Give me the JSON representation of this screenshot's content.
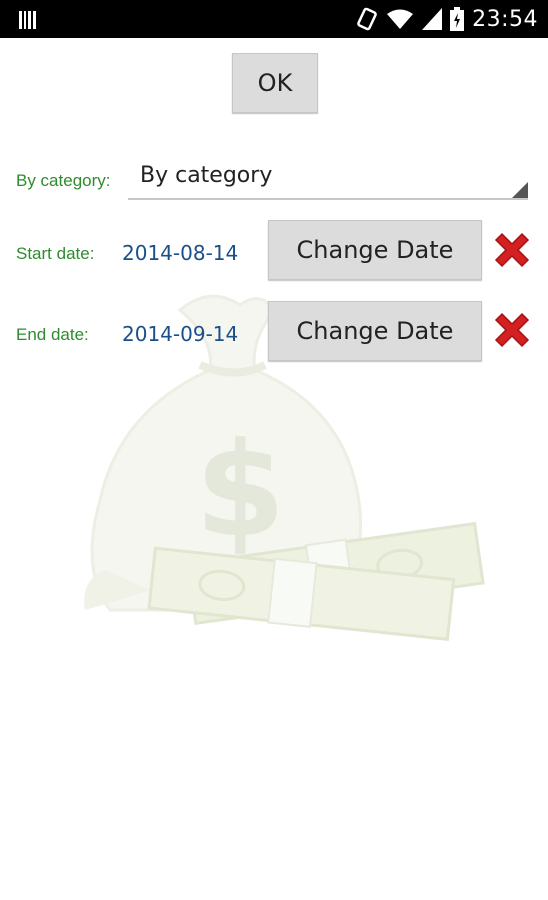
{
  "status_bar": {
    "time": "23:54",
    "icons": [
      "barcode-icon",
      "rotate-icon",
      "wifi-icon",
      "signal-icon",
      "battery-icon"
    ]
  },
  "form": {
    "ok_label": "OK",
    "category": {
      "label": "By category:",
      "selected": "By category"
    },
    "start_date": {
      "label": "Start date:",
      "value": "2014-08-14",
      "button_label": "Change Date"
    },
    "end_date": {
      "label": "End date:",
      "value": "2014-09-14",
      "button_label": "Change Date"
    }
  },
  "colors": {
    "label_green": "#2e8b2e",
    "value_blue": "#1a4f8a",
    "clear_red": "#d42020"
  }
}
